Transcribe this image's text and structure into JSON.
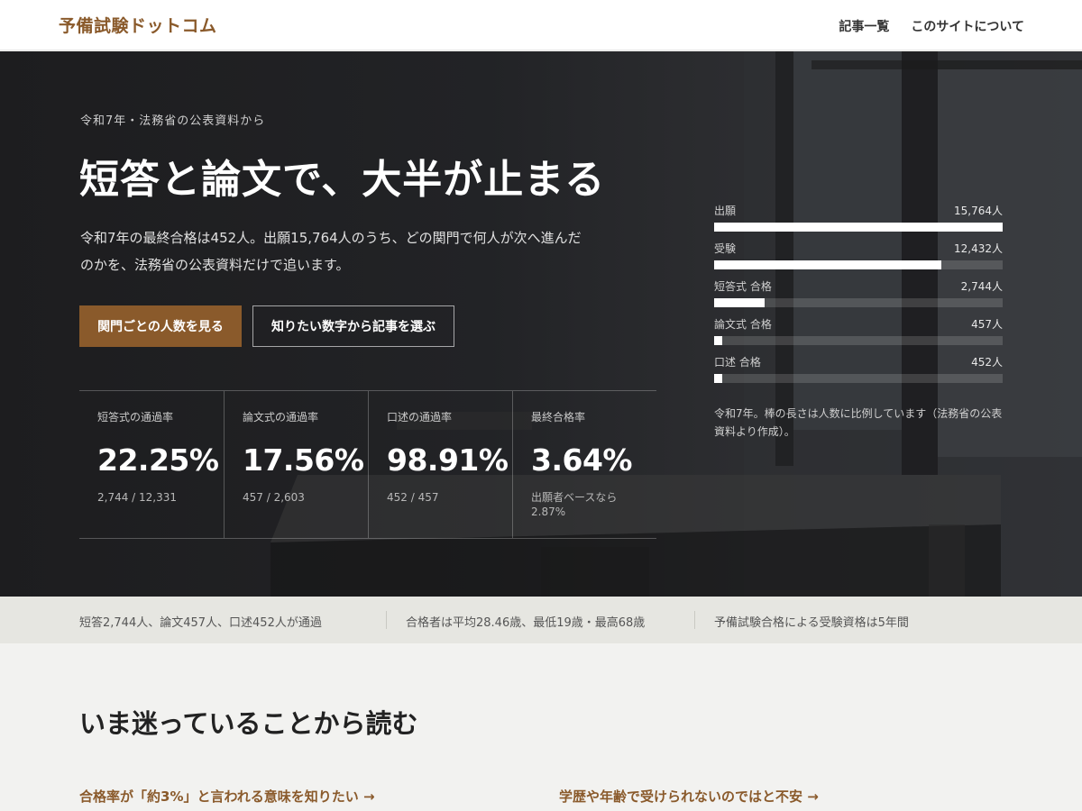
{
  "header": {
    "brand": "予備試験ドットコム",
    "nav": [
      "記事一覧",
      "このサイトについて"
    ]
  },
  "hero": {
    "eyebrow": "令和7年・法務省の公表資料から",
    "headline": "短答と論文で、大半が止まる",
    "lede": "令和7年の最終合格は452人。出願15,764人のうち、どの関門で何人が次へ進んだのかを、法務省の公表資料だけで追います。",
    "primary_button": "関門ごとの人数を見る",
    "secondary_button": "知りたい数字から記事を選ぶ"
  },
  "stats": [
    {
      "label": "短答式の通過率",
      "value": "22.25%",
      "note": "2,744 / 12,331"
    },
    {
      "label": "論文式の通過率",
      "value": "17.56%",
      "note": "457 / 2,603"
    },
    {
      "label": "口述の通過率",
      "value": "98.91%",
      "note": "452 / 457"
    },
    {
      "label": "最終合格率",
      "value": "3.64%",
      "note": "出願者ベースなら\n2.87%"
    }
  ],
  "funnel": {
    "rows": [
      {
        "label": "出願",
        "value_text": "15,764人",
        "value": 15764
      },
      {
        "label": "受験",
        "value_text": "12,432人",
        "value": 12432
      },
      {
        "label": "短答式 合格",
        "value_text": "2,744人",
        "value": 2744
      },
      {
        "label": "論文式 合格",
        "value_text": "457人",
        "value": 457
      },
      {
        "label": "口述 合格",
        "value_text": "452人",
        "value": 452
      }
    ],
    "caption": "令和7年。棒の長さは人数に比例しています（法務省の公表資料より作成）。"
  },
  "facts": [
    "短答2,744人、論文457人、口述452人が通過",
    "合格者は平均28.46歳、最低19歳・最高68歳",
    "予備試験合格による受験資格は5年間"
  ],
  "section": {
    "title": "いま迷っていることから読む",
    "topics": [
      "合格率が「約3%」と言われる意味を知りたい →",
      "学歴や年齢で受けられないのではと不安 →"
    ]
  },
  "colors": {
    "accent": "#8a5a2b",
    "hero_bg": "#222326",
    "strip_bg": "#e6e6e1",
    "page_bg": "#f2f2f0"
  }
}
